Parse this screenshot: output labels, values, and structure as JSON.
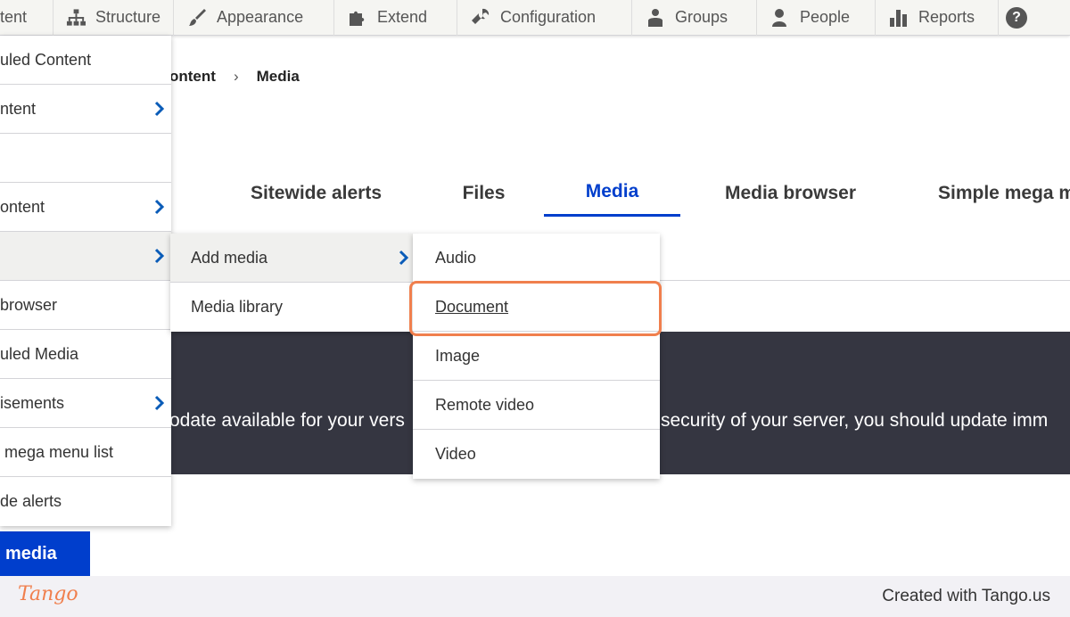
{
  "toolbar": {
    "items": [
      {
        "label": "tent",
        "icon": "content-icon"
      },
      {
        "label": "Structure",
        "icon": "sitemap-icon"
      },
      {
        "label": "Appearance",
        "icon": "paintbrush-icon"
      },
      {
        "label": "Extend",
        "icon": "puzzle-icon"
      },
      {
        "label": "Configuration",
        "icon": "wrench-icon"
      },
      {
        "label": "Groups",
        "icon": "groups-icon"
      },
      {
        "label": "People",
        "icon": "person-icon"
      },
      {
        "label": "Reports",
        "icon": "bar-chart-icon"
      }
    ],
    "help_label": "?"
  },
  "breadcrumb": {
    "parent": "ontent",
    "separator": "›",
    "current": "Media"
  },
  "tabs": [
    {
      "label": "Sitewide alerts"
    },
    {
      "label": "Files"
    },
    {
      "label": "Media",
      "active": true
    },
    {
      "label": "Media browser"
    },
    {
      "label": "Simple mega m"
    }
  ],
  "content_menu": {
    "items": [
      {
        "label": "uled Content",
        "has_submenu": false
      },
      {
        "label": "ntent",
        "has_submenu": true
      },
      {
        "label": "",
        "has_submenu": false
      },
      {
        "label": "ontent",
        "has_submenu": true
      },
      {
        "label": "",
        "has_submenu": true,
        "highlighted": true
      },
      {
        "label": "browser",
        "has_submenu": false
      },
      {
        "label": "uled Media",
        "has_submenu": false
      },
      {
        "label": "isements",
        "has_submenu": true
      },
      {
        "label": " mega menu list",
        "has_submenu": false
      },
      {
        "label": "de alerts",
        "has_submenu": false
      }
    ]
  },
  "media_menu": {
    "items": [
      {
        "label": "Add media",
        "has_submenu": true,
        "highlighted": true
      },
      {
        "label": "Media library",
        "has_submenu": false
      }
    ]
  },
  "add_media_menu": {
    "items": [
      {
        "label": "Audio"
      },
      {
        "label": "Document",
        "focused": true
      },
      {
        "label": "Image"
      },
      {
        "label": "Remote video"
      },
      {
        "label": "Video"
      }
    ]
  },
  "banner": {
    "text_left": "odate available for your vers",
    "text_right": "security of your server, you should update imm"
  },
  "add_media_button": {
    "label": "media"
  },
  "footer": {
    "logo": "Tango",
    "credit": "Created with Tango.us"
  },
  "colors": {
    "accent": "#003ecc",
    "highlight_ring": "#f07f4d",
    "banner_bg": "#353641",
    "toolbar_bg": "#f5f5f2"
  }
}
